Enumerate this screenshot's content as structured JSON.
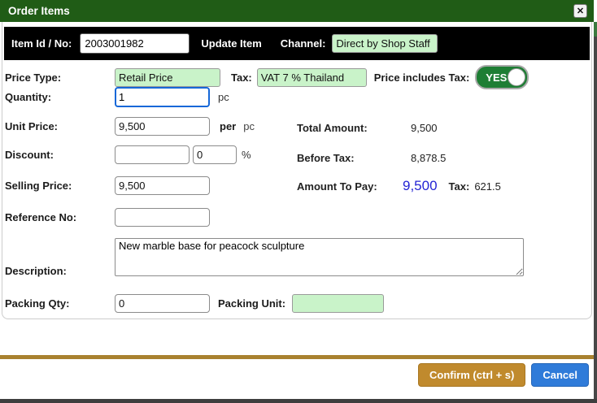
{
  "colors": {
    "titlebar_green": "#205c16",
    "field_green": "#c9f3c9",
    "toggle_green": "#1e7e34",
    "focus_blue": "#1668d8",
    "amount_blue": "#2424d4",
    "confirm_gold": "#c08a2d",
    "cancel_blue": "#2f7bd9",
    "separator_gold": "#a9822f"
  },
  "titlebar": {
    "title": "Order Items",
    "close_icon": "✕"
  },
  "itembar": {
    "item_id_label": "Item Id / No:",
    "item_id_value": "2003001982",
    "update_item_label": "Update Item",
    "channel_label": "Channel:",
    "channel_value": "Direct by Shop Staff"
  },
  "form": {
    "price_type": {
      "label": "Price Type:",
      "value": "Retail Price"
    },
    "tax": {
      "label": "Tax:",
      "value": "VAT 7 % Thailand"
    },
    "price_includes_tax": {
      "label": "Price includes Tax:",
      "state": "YES"
    },
    "quantity": {
      "label": "Quantity:",
      "value": "1",
      "unit": "pc"
    },
    "unit_price": {
      "label": "Unit Price:",
      "value": "9,500",
      "per": "per",
      "unit": "pc"
    },
    "discount": {
      "label": "Discount:",
      "amount": "",
      "percent": "0",
      "percent_sign": "%"
    },
    "selling_price": {
      "label": "Selling Price:",
      "value": "9,500"
    },
    "reference_no": {
      "label": "Reference No:",
      "value": ""
    },
    "description": {
      "label": "Description:",
      "value": "New marble base for peacock sculpture"
    },
    "packing_qty": {
      "label": "Packing Qty:",
      "value": "0"
    },
    "packing_unit": {
      "label": "Packing Unit:",
      "value": ""
    }
  },
  "summary": {
    "total_amount": {
      "label": "Total Amount:",
      "value": "9,500"
    },
    "before_tax": {
      "label": "Before Tax:",
      "value": "8,878.5"
    },
    "amount_to_pay": {
      "label": "Amount To Pay:",
      "value": "9,500",
      "tax_label": "Tax:",
      "tax_value": "621.5"
    }
  },
  "footer": {
    "confirm_label": "Confirm (ctrl + s)",
    "cancel_label": "Cancel"
  }
}
